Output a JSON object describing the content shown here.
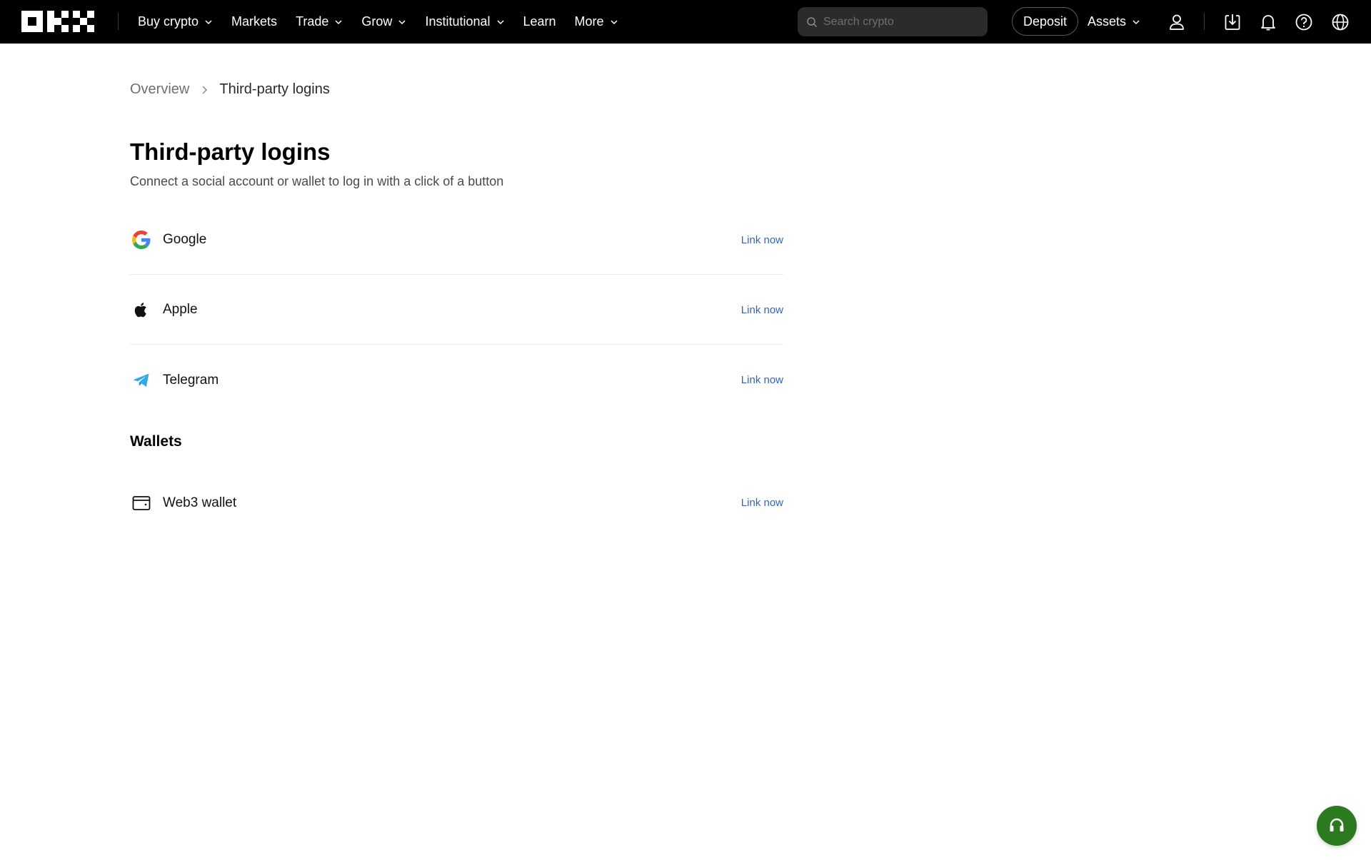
{
  "nav": {
    "items": [
      {
        "label": "Buy crypto",
        "dropdown": true
      },
      {
        "label": "Markets",
        "dropdown": false
      },
      {
        "label": "Trade",
        "dropdown": true
      },
      {
        "label": "Grow",
        "dropdown": true
      },
      {
        "label": "Institutional",
        "dropdown": true
      },
      {
        "label": "Learn",
        "dropdown": false
      },
      {
        "label": "More",
        "dropdown": true
      }
    ],
    "search_placeholder": "Search crypto",
    "deposit_label": "Deposit",
    "assets_label": "Assets",
    "icons": [
      "user-icon",
      "download-icon",
      "bell-icon",
      "help-icon",
      "globe-icon"
    ]
  },
  "breadcrumb": {
    "overview": "Overview",
    "current": "Third-party logins"
  },
  "page": {
    "title": "Third-party logins",
    "subtitle": "Connect a social account or wallet to log in with a click of a button"
  },
  "social_logins": [
    {
      "name": "Google",
      "icon": "google-icon",
      "action": "Link now"
    },
    {
      "name": "Apple",
      "icon": "apple-icon",
      "action": "Link now"
    },
    {
      "name": "Telegram",
      "icon": "telegram-icon",
      "action": "Link now"
    }
  ],
  "wallets": {
    "title": "Wallets",
    "items": [
      {
        "name": "Web3 wallet",
        "icon": "wallet-icon",
        "action": "Link now"
      }
    ]
  },
  "colors": {
    "nav_bg": "#000000",
    "link": "#2e63d9",
    "support_bg": "#2b7a1f"
  }
}
